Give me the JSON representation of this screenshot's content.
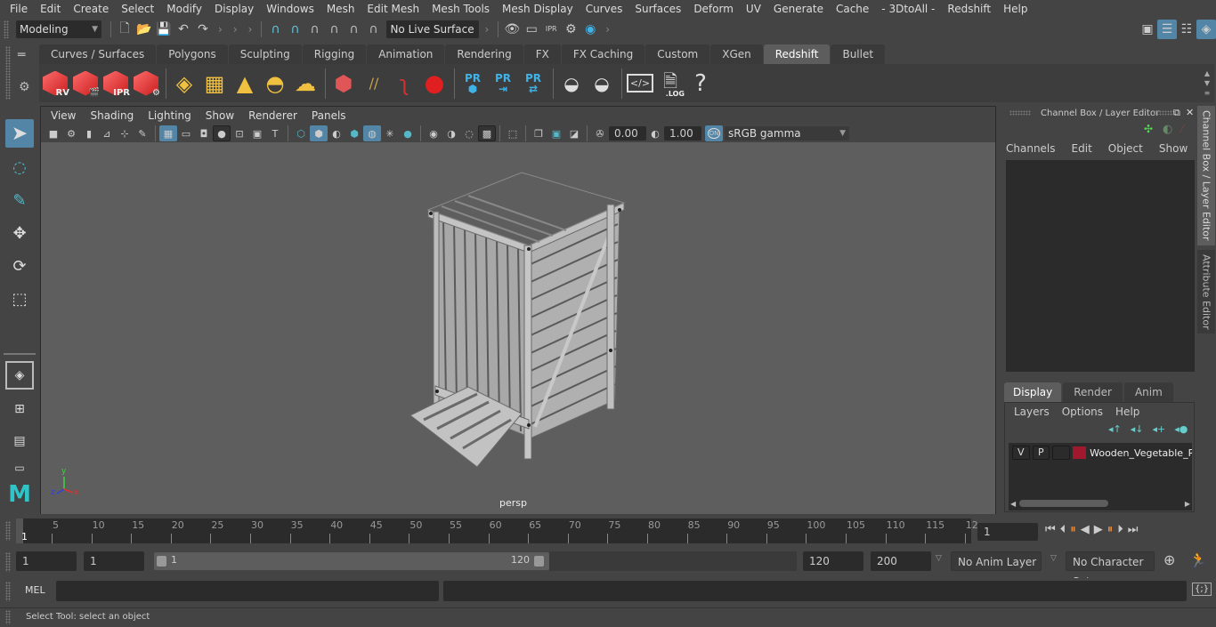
{
  "menubar": [
    "File",
    "Edit",
    "Create",
    "Select",
    "Modify",
    "Display",
    "Windows",
    "Mesh",
    "Edit Mesh",
    "Mesh Tools",
    "Mesh Display",
    "Curves",
    "Surfaces",
    "Deform",
    "UV",
    "Generate",
    "Cache",
    "- 3DtoAll -",
    "Redshift",
    "Help"
  ],
  "statusline": {
    "mode": "Modeling",
    "live_surface": "No Live Surface"
  },
  "shelf": {
    "tabs": [
      "Curves / Surfaces",
      "Polygons",
      "Sculpting",
      "Rigging",
      "Animation",
      "Rendering",
      "FX",
      "FX Caching",
      "Custom",
      "XGen",
      "Redshift",
      "Bullet"
    ],
    "active_tab": "Redshift",
    "labels": {
      "rv": "RV",
      "ipr": "IPR",
      "pr": "PR",
      "log": ".LOG",
      "help": "?"
    }
  },
  "viewport": {
    "menu": [
      "View",
      "Shading",
      "Lighting",
      "Show",
      "Renderer",
      "Panels"
    ],
    "exposure": "0.00",
    "gamma": "1.00",
    "color_mgmt_on": "ON",
    "color_space": "sRGB gamma",
    "camera": "persp",
    "axis": {
      "x": "x",
      "y": "y",
      "z": "z"
    }
  },
  "channel_box": {
    "title": "Channel Box / Layer Editor",
    "menu": [
      "Channels",
      "Edit",
      "Object",
      "Show"
    ]
  },
  "layer_editor": {
    "tabs": [
      "Display",
      "Render",
      "Anim"
    ],
    "active_tab": "Display",
    "menu": [
      "Layers",
      "Options",
      "Help"
    ],
    "layers": [
      {
        "v": "V",
        "p": "P",
        "color": "#a0182e",
        "name": "Wooden_Vegetable_R"
      }
    ]
  },
  "side_tabs": [
    "Channel Box / Layer Editor",
    "Attribute Editor"
  ],
  "timeline": {
    "current_frame_marker": "1",
    "ticks": [
      "5",
      "10",
      "15",
      "20",
      "25",
      "30",
      "35",
      "40",
      "45",
      "50",
      "55",
      "60",
      "65",
      "70",
      "75",
      "80",
      "85",
      "90",
      "95",
      "100",
      "105",
      "110",
      "115",
      "12"
    ],
    "current_frame": "1"
  },
  "range": {
    "start": "1",
    "playback_start": "1",
    "slider_start": "1",
    "slider_end": "120",
    "playback_end": "120",
    "end": "200",
    "anim_layer": "No Anim Layer",
    "character_set": "No Character Set"
  },
  "command": {
    "lang": "MEL"
  },
  "help_line": "Select Tool: select an object"
}
